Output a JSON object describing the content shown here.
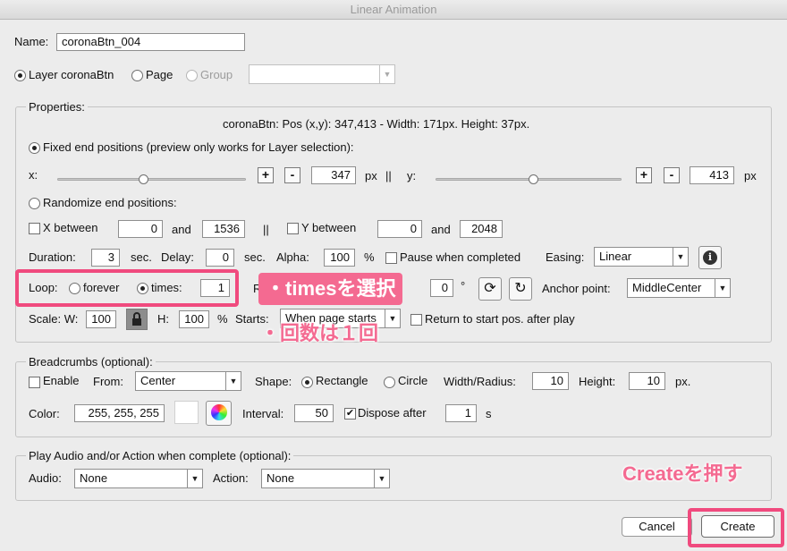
{
  "window": {
    "title": "Linear Animation"
  },
  "name": {
    "label": "Name:",
    "value": "coronaBtn_004"
  },
  "target": {
    "layer_label": "Layer coronaBtn",
    "page_label": "Page",
    "group_label": "Group",
    "group_value": ""
  },
  "properties": {
    "legend": "Properties:",
    "info": "coronaBtn: Pos (x,y): 347,413 - Width: 171px. Height: 37px.",
    "fixed_label": "Fixed end positions (preview only works for Layer selection):",
    "x_label": "x:",
    "x_value": "347",
    "px": "px",
    "sep": "||",
    "y_label": "y:",
    "y_value": "413",
    "x_slider": 0.46,
    "y_slider": 0.53,
    "plus": "+",
    "minus": "-",
    "randomize_label": "Randomize end positions:",
    "x_between_label": "X between",
    "x_between_min": "0",
    "and": "and",
    "x_between_max": "1536",
    "y_between_label": "Y between",
    "y_between_min": "0",
    "y_between_max": "2048",
    "duration_label": "Duration:",
    "duration_value": "3",
    "sec": "sec.",
    "delay_label": "Delay:",
    "delay_value": "0",
    "alpha_label": "Alpha:",
    "alpha_value": "100",
    "percent": "%",
    "pause_label": "Pause when completed",
    "easing_label": "Easing:",
    "easing_value": "Linear",
    "info_icon": "i",
    "loop_label": "Loop:",
    "forever_label": "forever",
    "times_label": "times:",
    "times_value": "1",
    "rotate_label": "Ro",
    "rotate_value": "0",
    "degree": "°",
    "anchor_label": "Anchor point:",
    "anchor_value": "MiddleCenter",
    "scale_label": "Scale: W:",
    "scale_w": "100",
    "h_label": "H:",
    "scale_h": "100",
    "starts_label": "Starts:",
    "starts_value": "When page starts",
    "return_label": "Return to start pos. after play"
  },
  "breadcrumbs": {
    "legend": "Breadcrumbs (optional):",
    "enable_label": "Enable",
    "from_label": "From:",
    "from_value": "Center",
    "shape_label": "Shape:",
    "rectangle_label": "Rectangle",
    "circle_label": "Circle",
    "width_label": "Width/Radius:",
    "width_value": "10",
    "height_label": "Height:",
    "height_value": "10",
    "px": "px.",
    "color_label": "Color:",
    "color_value": "255, 255, 255",
    "swatch_color": "#ffffff",
    "interval_label": "Interval:",
    "interval_value": "50",
    "dispose_label": "Dispose after",
    "dispose_value": "1",
    "s": "s"
  },
  "audio": {
    "legend": "Play Audio and/or Action when complete (optional):",
    "audio_label": "Audio:",
    "audio_value": "None",
    "action_label": "Action:",
    "action_value": "None"
  },
  "buttons": {
    "cancel": "Cancel",
    "create": "Create"
  },
  "annotations": {
    "select_times": "・timesを選択",
    "count_once": "・回数は１回",
    "press_create": "Createを押す",
    "color": "#f04a7e"
  }
}
